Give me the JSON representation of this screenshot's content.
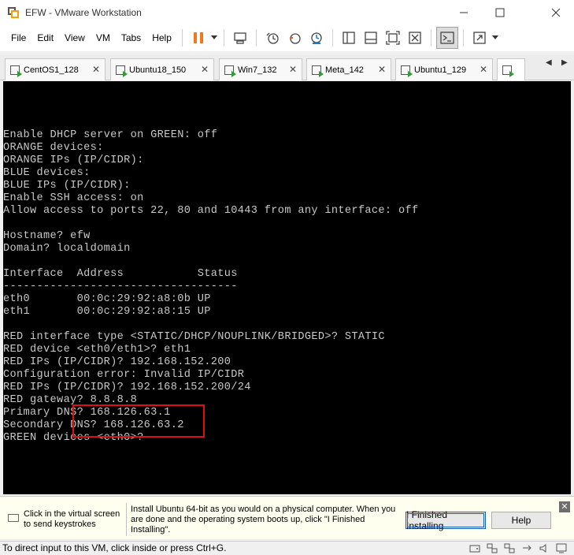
{
  "window": {
    "title": "EFW - VMware Workstation"
  },
  "menu": [
    "File",
    "Edit",
    "View",
    "VM",
    "Tabs",
    "Help"
  ],
  "tabs": [
    {
      "label": "CentOS1_128"
    },
    {
      "label": "Ubuntu18_150"
    },
    {
      "label": "Win7_132"
    },
    {
      "label": "Meta_142"
    },
    {
      "label": "Ubuntu1_129"
    }
  ],
  "console": {
    "lines": [
      "Enable DHCP server on GREEN: off",
      "ORANGE devices:",
      "ORANGE IPs (IP/CIDR):",
      "BLUE devices:",
      "BLUE IPs (IP/CIDR):",
      "Enable SSH access: on",
      "Allow access to ports 22, 80 and 10443 from any interface: off",
      "",
      "Hostname? efw",
      "Domain? localdomain",
      "",
      "Interface  Address           Status",
      "-----------------------------------",
      "eth0       00:0c:29:92:a8:0b UP",
      "eth1       00:0c:29:92:a8:15 UP",
      "",
      "RED interface type <STATIC/DHCP/NOUPLINK/BRIDGED>? STATIC",
      "RED device <eth0/eth1>? eth1",
      "RED IPs (IP/CIDR)? 192.168.152.200",
      "Configuration error: Invalid IP/CIDR",
      "RED IPs (IP/CIDR)? 192.168.152.200/24",
      "RED gateway? 8.8.8.8",
      "Primary DNS? 168.126.63.1",
      "Secondary DNS? 168.126.63.2",
      "GREEN devices <eth0>?"
    ]
  },
  "infobar": {
    "keystroke_hint": "Click in the virtual screen to send keystrokes",
    "message": "Install Ubuntu 64-bit as you would on a physical computer. When you are done and the operating system boots up, click \"I Finished Installing\".",
    "finished_button": "I Finished Installing",
    "help_button": "Help",
    "close_glyph": "✕"
  },
  "statusbar": {
    "text": "To direct input to this VM, click inside or press Ctrl+G."
  },
  "colors": {
    "console_bg": "#000000",
    "console_text": "#c8c8c8",
    "highlight": "#e01010",
    "infobar_bg": "#fffff0",
    "pause_icon": "#f07820"
  }
}
